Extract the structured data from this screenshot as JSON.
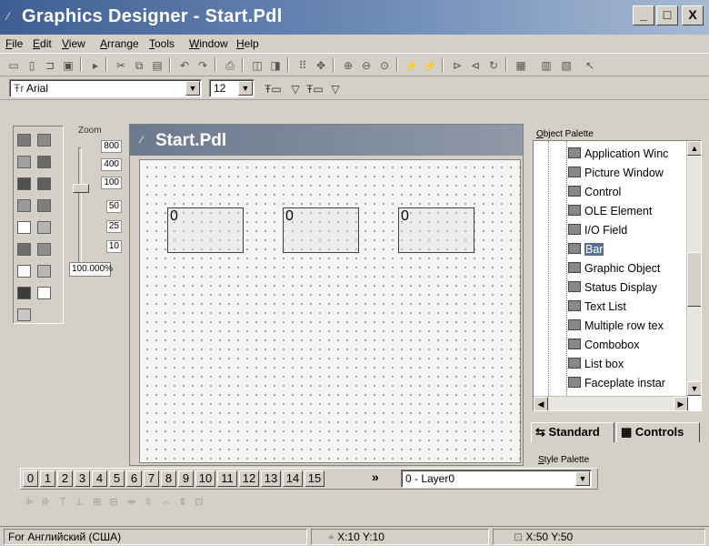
{
  "app": {
    "title": "Graphics Designer - Start.Pdl"
  },
  "window_controls": {
    "minimize": "_",
    "maximize": "□",
    "close": "X"
  },
  "menu": [
    "File",
    "Edit",
    "View",
    "Arrange",
    "Tools",
    "Window",
    "Help"
  ],
  "font_toolbar": {
    "font_name": "Arial",
    "font_size": "12"
  },
  "zoom": {
    "label": "Zoom",
    "levels": [
      "800",
      "400",
      "100",
      "50",
      "25",
      "10"
    ],
    "value": "100.000",
    "unit": "%"
  },
  "color_palette": {
    "colors": [
      "#7a7a7a",
      "#8a8a8a",
      "#a0a0a0",
      "#6a6a6a",
      "#505050",
      "#5e5e5e",
      "#9a9a9a",
      "#7e7e7e",
      "#ffffff",
      "#b4b4b4",
      "#6e6e6e",
      "#8e8e8e",
      "#f8f8f8",
      "#b8b8b8",
      "#3c3c3c",
      "#ffffff"
    ]
  },
  "document": {
    "title": "Start.Pdl",
    "io_fields": [
      "0",
      "0",
      "0"
    ]
  },
  "object_palette": {
    "caption": "Object Palette",
    "items": [
      {
        "label": "Application Winc",
        "icon": "application-window-icon",
        "selected": false
      },
      {
        "label": "Picture Window",
        "icon": "picture-window-icon",
        "selected": false
      },
      {
        "label": "Control",
        "icon": "control-icon",
        "selected": false
      },
      {
        "label": "OLE Element",
        "icon": "ole-element-icon",
        "selected": false
      },
      {
        "label": "I/O Field",
        "icon": "io-field-icon",
        "selected": false
      },
      {
        "label": "Bar",
        "icon": "bar-icon",
        "selected": true
      },
      {
        "label": "Graphic Object",
        "icon": "graphic-object-icon",
        "selected": false
      },
      {
        "label": "Status Display",
        "icon": "status-display-icon",
        "selected": false
      },
      {
        "label": "Text List",
        "icon": "text-list-icon",
        "selected": false
      },
      {
        "label": "Multiple row tex",
        "icon": "multiple-row-text-icon",
        "selected": false
      },
      {
        "label": "Combobox",
        "icon": "combobox-icon",
        "selected": false
      },
      {
        "label": "List box",
        "icon": "list-box-icon",
        "selected": false
      },
      {
        "label": "Faceplate instar",
        "icon": "faceplate-instance-icon",
        "selected": false
      }
    ],
    "tabs": [
      "Standard",
      "Controls"
    ]
  },
  "style_palette": {
    "caption": "Style Palette"
  },
  "layers": {
    "buttons": [
      "0",
      "1",
      "2",
      "3",
      "4",
      "5",
      "6",
      "7",
      "8",
      "9",
      "10",
      "11",
      "12",
      "13",
      "14",
      "15"
    ],
    "more": "»",
    "current": "0 - Layer0"
  },
  "status": {
    "language": "For Английский (США)",
    "position": "X:10 Y:10",
    "size": "X:50 Y:50"
  }
}
